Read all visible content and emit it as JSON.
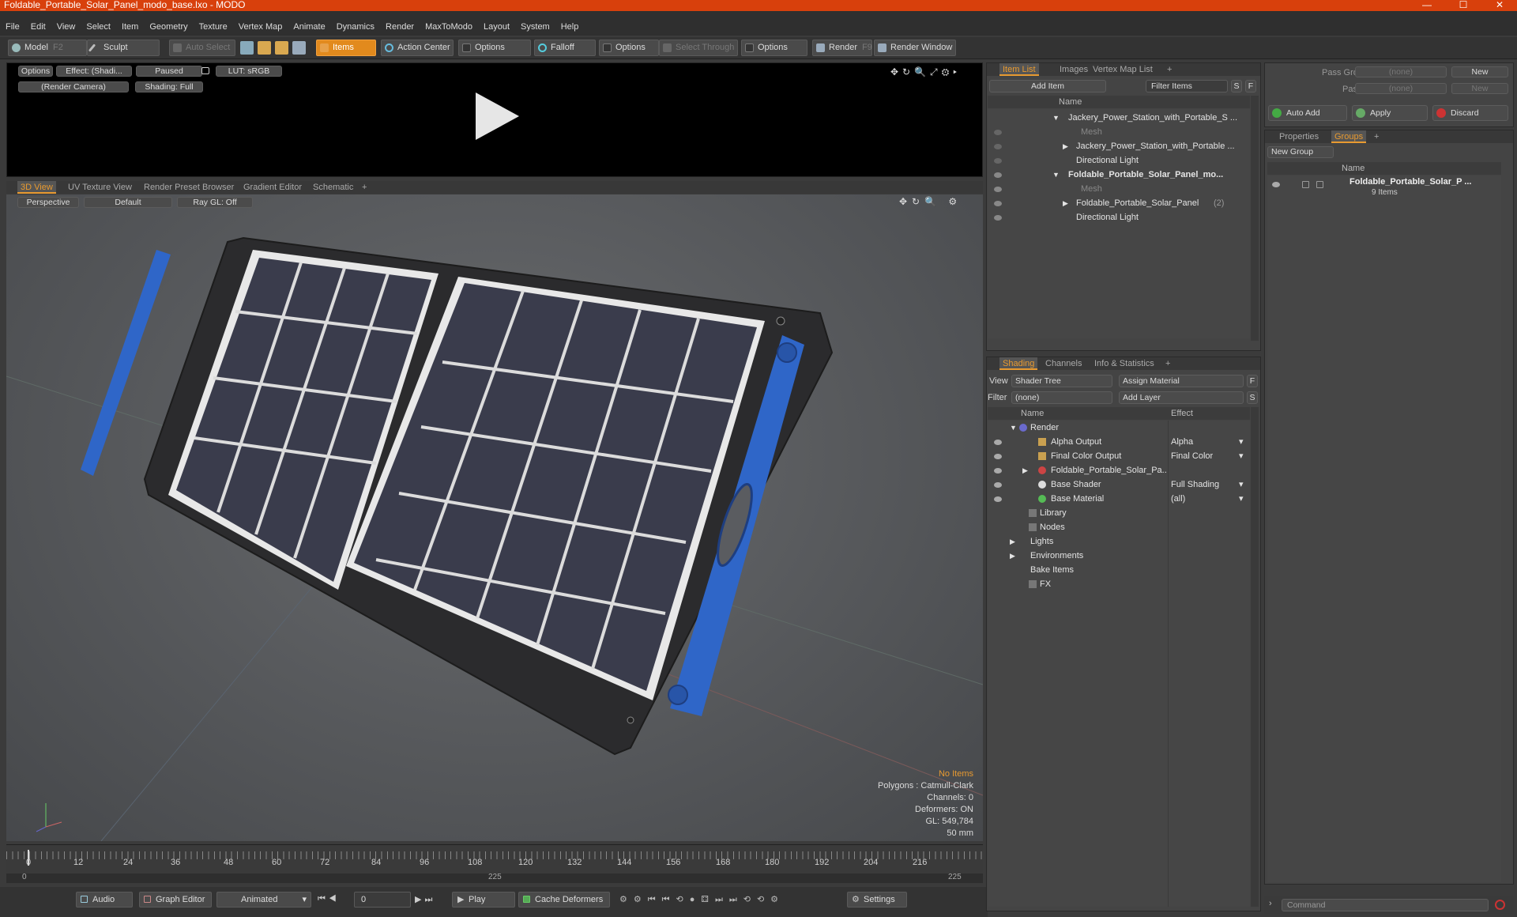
{
  "window": {
    "title": "Foldable_Portable_Solar_Panel_modo_base.lxo - MODO",
    "minimize": "—",
    "maximize": "☐",
    "close": "✕"
  },
  "menu": [
    "File",
    "Edit",
    "View",
    "Select",
    "Item",
    "Geometry",
    "Texture",
    "Vertex Map",
    "Animate",
    "Dynamics",
    "Render",
    "MaxToModo",
    "Layout",
    "System",
    "Help"
  ],
  "toolbar": {
    "model": "Model",
    "model_key": "F2",
    "sculpt": "Sculpt",
    "auto_select": "Auto Select",
    "items": "Items",
    "action_center": "Action Center",
    "options1": "Options",
    "falloff": "Falloff",
    "options2": "Options",
    "select_through": "Select Through",
    "options3": "Options",
    "render": "Render",
    "render_key": "F9",
    "render_window": "Render Window"
  },
  "preview": {
    "options": "Options",
    "effect": "Effect: (Shadi...",
    "paused": "Paused",
    "lut": "LUT: sRGB",
    "camera": "(Render Camera)",
    "shading": "Shading: Full"
  },
  "viewport_tabs": [
    "3D View",
    "UV Texture View",
    "Render Preset Browser",
    "Gradient Editor",
    "Schematic",
    "+"
  ],
  "viewport": {
    "perspective": "Perspective",
    "default": "Default",
    "raygl": "Ray GL: Off",
    "stats": {
      "no_items": "No Items",
      "polygons": "Polygons : Catmull-Clark",
      "channels": "Channels: 0",
      "deformers": "Deformers: ON",
      "gl": "GL: 549,784",
      "focal": "50 mm"
    }
  },
  "timeline": {
    "ticks": [
      "0",
      "12",
      "24",
      "36",
      "48",
      "60",
      "72",
      "84",
      "96",
      "108",
      "120",
      "132",
      "144",
      "156",
      "168",
      "180",
      "192",
      "204",
      "216"
    ],
    "start": "0",
    "mid": "225",
    "end": "225"
  },
  "bottombar": {
    "audio": "Audio",
    "graph_editor": "Graph Editor",
    "animated": "Animated",
    "frame": "0",
    "play": "Play",
    "cache": "Cache Deformers",
    "settings": "Settings"
  },
  "itemlist": {
    "tabs": [
      "Item List",
      "Images",
      "Vertex Map List",
      "+"
    ],
    "add_item": "Add Item",
    "filter": "Filter Items",
    "s": "S",
    "f": "F",
    "col_name": "Name",
    "rows": [
      {
        "label": "Jackery_Power_Station_with_Portable_S ...",
        "indent": 0,
        "bold": false,
        "dim": false
      },
      {
        "label": "Mesh",
        "indent": 1,
        "bold": false,
        "dim": true
      },
      {
        "label": "Jackery_Power_Station_with_Portable ...",
        "indent": 1,
        "bold": false,
        "dim": false
      },
      {
        "label": "Directional Light",
        "indent": 1,
        "bold": false,
        "dim": false
      },
      {
        "label": "Foldable_Portable_Solar_Panel_mo...",
        "indent": 0,
        "bold": true,
        "dim": false
      },
      {
        "label": "Mesh",
        "indent": 1,
        "bold": false,
        "dim": true
      },
      {
        "label": "Foldable_Portable_Solar_Panel",
        "indent": 1,
        "bold": false,
        "dim": false,
        "suffix": "(2)"
      },
      {
        "label": "Directional Light",
        "indent": 1,
        "bold": false,
        "dim": false
      }
    ]
  },
  "shading": {
    "tabs": [
      "Shading",
      "Channels",
      "Info & Statistics",
      "+"
    ],
    "view_label": "View",
    "view_value": "Shader Tree",
    "assign": "Assign Material",
    "f": "F",
    "filter_label": "Filter",
    "filter_value": "(none)",
    "add_layer": "Add Layer",
    "s": "S",
    "col_name": "Name",
    "col_effect": "Effect",
    "rows": [
      {
        "label": "Render",
        "effect": ""
      },
      {
        "label": "Alpha Output",
        "effect": "Alpha"
      },
      {
        "label": "Final Color Output",
        "effect": "Final Color"
      },
      {
        "label": "Foldable_Portable_Solar_Pa...",
        "effect": ""
      },
      {
        "label": "Base Shader",
        "effect": "Full Shading"
      },
      {
        "label": "Base Material",
        "effect": "(all)"
      },
      {
        "label": "Library",
        "effect": ""
      },
      {
        "label": "Nodes",
        "effect": ""
      },
      {
        "label": "Lights",
        "effect": ""
      },
      {
        "label": "Environments",
        "effect": ""
      },
      {
        "label": "Bake Items",
        "effect": ""
      },
      {
        "label": "FX",
        "effect": ""
      }
    ]
  },
  "passes": {
    "pass_groups": "Pass Groups",
    "passes": "Passes",
    "none1": "(none)",
    "none2": "(none)",
    "new1": "New",
    "new2": "New",
    "auto_add": "Auto Add",
    "apply": "Apply",
    "discard": "Discard"
  },
  "groups": {
    "tabs": [
      "Properties",
      "Groups",
      "+"
    ],
    "new_group": "New Group",
    "col_name": "Name",
    "item": "Foldable_Portable_Solar_P ...",
    "count": "9 Items"
  },
  "command": {
    "placeholder": "Command"
  },
  "colors": {
    "accent": "#e89a30",
    "titlebar": "#d8400c",
    "panel_blue": "#2f66c8"
  }
}
